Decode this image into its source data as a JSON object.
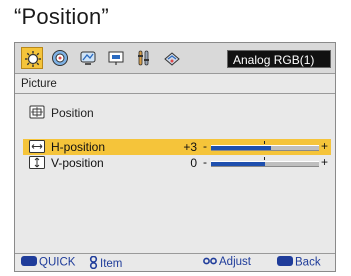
{
  "caption": "“Position”",
  "menu": {
    "tabs": [
      {
        "icon": "picture-adjust-icon",
        "active": true
      },
      {
        "icon": "color-icon",
        "active": false
      },
      {
        "icon": "display-icon",
        "active": false
      },
      {
        "icon": "screen-icon",
        "active": false
      },
      {
        "icon": "setup-icon",
        "active": false
      },
      {
        "icon": "network-icon",
        "active": false
      }
    ],
    "input_source": "Analog RGB(1)"
  },
  "section_title": "Picture",
  "submenu_title": "Position",
  "rows": [
    {
      "label": "H-position",
      "value": "+3",
      "level": 0.56,
      "selected": true
    },
    {
      "label": "V-position",
      "value": "0",
      "level": 0.5,
      "selected": false
    }
  ],
  "footer": {
    "quick": "QUICK",
    "item": "Item",
    "adjust": "Adjust",
    "back": "Back",
    "quick_key": "MENU",
    "back_key": "RETURN"
  },
  "colors": {
    "highlight": "#f5c43a",
    "slider_fill": "#1e4fae",
    "footer_text": "#1f3c9a"
  }
}
